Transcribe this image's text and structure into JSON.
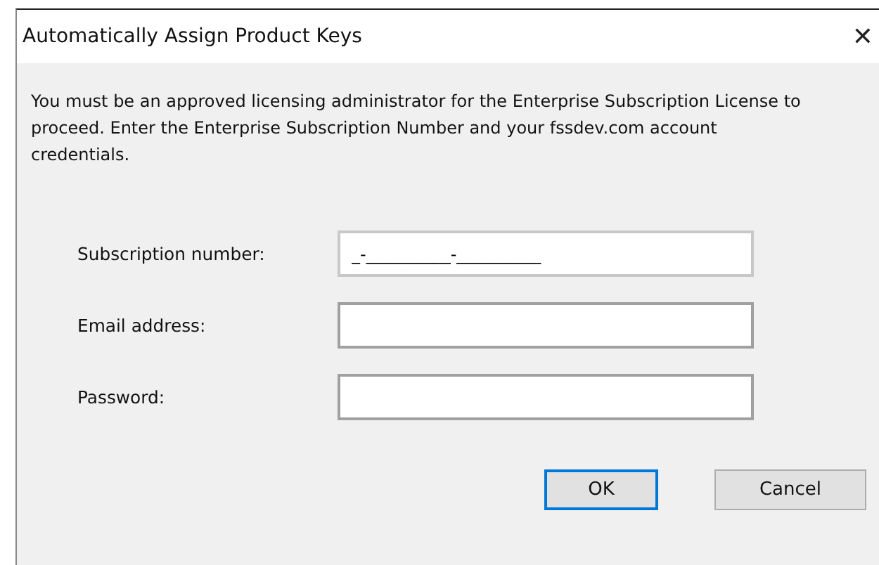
{
  "window": {
    "title": "Automatically Assign Product Keys",
    "close": "✕"
  },
  "message": "You must be an approved licensing administrator for the Enterprise Subscription License to proceed. Enter the Enterprise Subscription Number and your fssdev.com account credentials.",
  "fields": [
    {
      "label": "Subscription number:",
      "value": "_-__________-__________"
    },
    {
      "label": "Email address:"
    },
    {
      "label": "Password:"
    }
  ],
  "buttons": [
    {
      "label": "OK",
      "default": true
    },
    {
      "label": "Cancel",
      "default": false
    }
  ]
}
